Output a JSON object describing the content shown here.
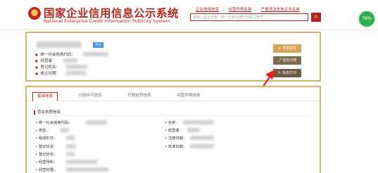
{
  "header": {
    "title": "国家企业信用信息公示系统",
    "subtitle": "National Enterprise Credit Information Publicity System",
    "links": [
      "企业信用信息",
      "经营异常名录",
      "严重违法失信企业名单"
    ],
    "search_placeholder": "请输入企业名称、统一社会信用代码或注册号",
    "search_icon": "search-icon",
    "progress": "78%"
  },
  "summary": {
    "tag": "开业",
    "rows": [
      "统一社会信用代码：",
      "经营者：",
      "登记机关：",
      "成立日期："
    ]
  },
  "actions": {
    "report": "发送报告",
    "share": "信息分享",
    "print": "信息打印"
  },
  "tabs": [
    "基础信息",
    "行政许可信息",
    "行政处罚信息",
    "经营异常信息"
  ],
  "detail": {
    "section_title": "营业执照信息",
    "left_fields": [
      "统一社会信用代码：",
      "类型：",
      "组成形式：",
      "登记机关：",
      "登记状态：",
      "经营场所：",
      "经营范围："
    ],
    "right_fields": [
      "名称：",
      "经营者：",
      "注册日期：",
      "核准日期："
    ]
  },
  "colors": {
    "brand": "#b1281e",
    "border": "#d7b26a",
    "accent_green": "#2fae4e"
  }
}
